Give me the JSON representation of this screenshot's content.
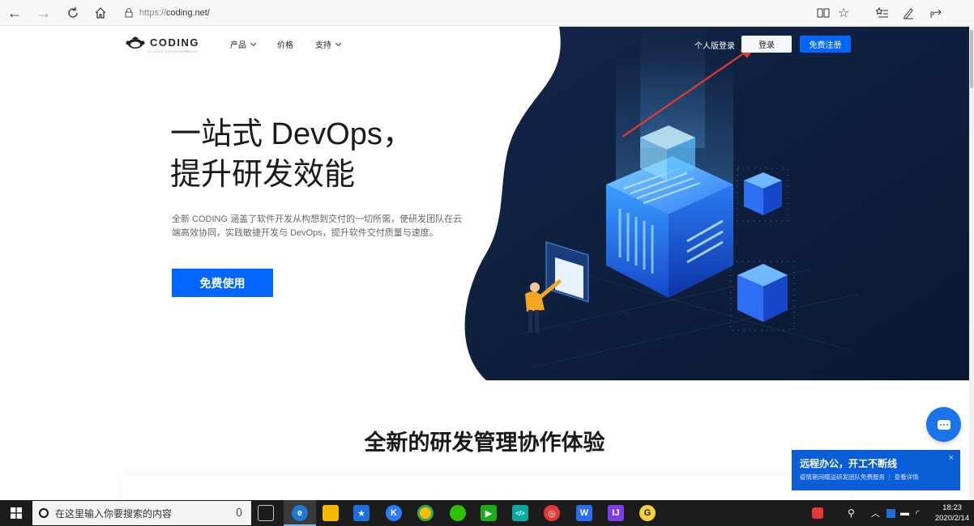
{
  "browser": {
    "url_scheme": "https://",
    "url_host": "coding.net/",
    "nav_icons": [
      "back-arrow-icon",
      "forward-arrow-icon",
      "refresh-icon",
      "home-icon"
    ],
    "right_icons": [
      "reading-view-icon",
      "favorite-star-icon",
      "favorites-list-icon",
      "pen-icon",
      "share-icon"
    ]
  },
  "header": {
    "logo_text": "CODING",
    "logo_subtext": "CLOUD DEVELOPMENT",
    "nav": [
      {
        "label": "产品",
        "has_dropdown": true
      },
      {
        "label": "价格",
        "has_dropdown": false
      },
      {
        "label": "支持",
        "has_dropdown": true
      }
    ],
    "personal_login": "个人版登录",
    "login_label": "登录",
    "register_label": "免费注册"
  },
  "hero": {
    "title_line1": "一站式 DevOps，",
    "title_line2": "提升研发效能",
    "description": "全新 CODING 涵盖了软件开发从构想到交付的一切所需，使研发团队在云端高效协同，实践敏捷开发与 DevOps，提升软件交付质量与速度。",
    "cta_label": "免费使用"
  },
  "section": {
    "title": "全新的研发管理协作体验"
  },
  "promo": {
    "title": "远程办公，开工不断线",
    "subtitle": "疫情期间赠送研发团队免费服务 ｜ 查看详情",
    "close": "×"
  },
  "taskbar": {
    "search_placeholder": "在这里输入你要搜索的内容",
    "time": "18:23",
    "date": "2020/2/14"
  },
  "colors": {
    "brand_blue": "#0066ff",
    "hero_dark": "#0f1f3d",
    "promo_blue": "#0a5fd8",
    "annotation_red": "#e53935"
  }
}
